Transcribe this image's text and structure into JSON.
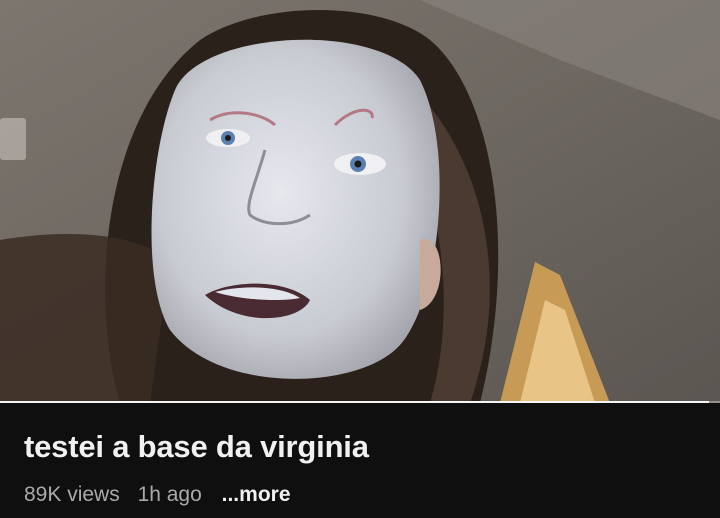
{
  "video": {
    "title": "testei a base da virginia",
    "views": "89K views",
    "age": "1h ago",
    "more_label": "...more",
    "progress_fraction": 0.985
  },
  "colors": {
    "background": "#0f0f0f",
    "title": "#f1f1f1",
    "meta": "#aaaaaa",
    "progress": "#f5f5f5"
  }
}
